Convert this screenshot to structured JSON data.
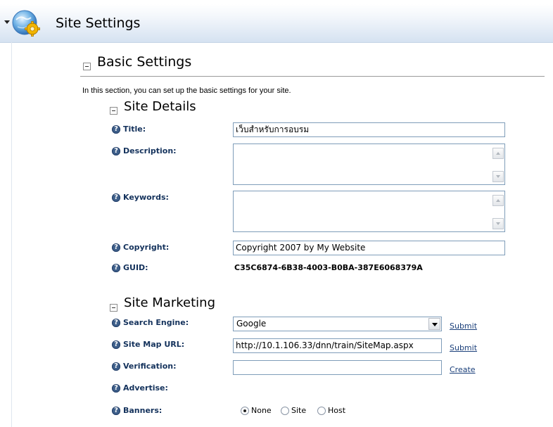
{
  "header": {
    "title": "Site Settings",
    "icon": "globe-gear-icon"
  },
  "basic_settings": {
    "title": "Basic Settings",
    "intro": "In this section, you can set up the basic settings for your site."
  },
  "site_details": {
    "title": "Site Details",
    "title_label": "Title:",
    "title_value": "เว็บสำหรับการอบรม",
    "description_label": "Description:",
    "description_value": "",
    "keywords_label": "Keywords:",
    "keywords_value": "",
    "copyright_label": "Copyright:",
    "copyright_value": "Copyright 2007 by My Website",
    "guid_label": "GUID:",
    "guid_value": "C35C6874-6B38-4003-B0BA-387E6068379A"
  },
  "site_marketing": {
    "title": "Site Marketing",
    "search_engine_label": "Search Engine:",
    "search_engine_value": "Google",
    "search_engine_link": "Submit",
    "sitemap_label": "Site Map URL:",
    "sitemap_value": "http://10.1.106.33/dnn/train/SiteMap.aspx",
    "sitemap_link": "Submit",
    "verification_label": "Verification:",
    "verification_value": "",
    "verification_link": "Create",
    "advertise_label": "Advertise:",
    "banners_label": "Banners:",
    "banner_options": [
      "None",
      "Site",
      "Host"
    ],
    "banner_selected": "None"
  },
  "colors": {
    "label": "#14325c",
    "link": "#1a3f7a",
    "help_icon": "#3e5f8a",
    "input_border": "#7f9db9"
  }
}
